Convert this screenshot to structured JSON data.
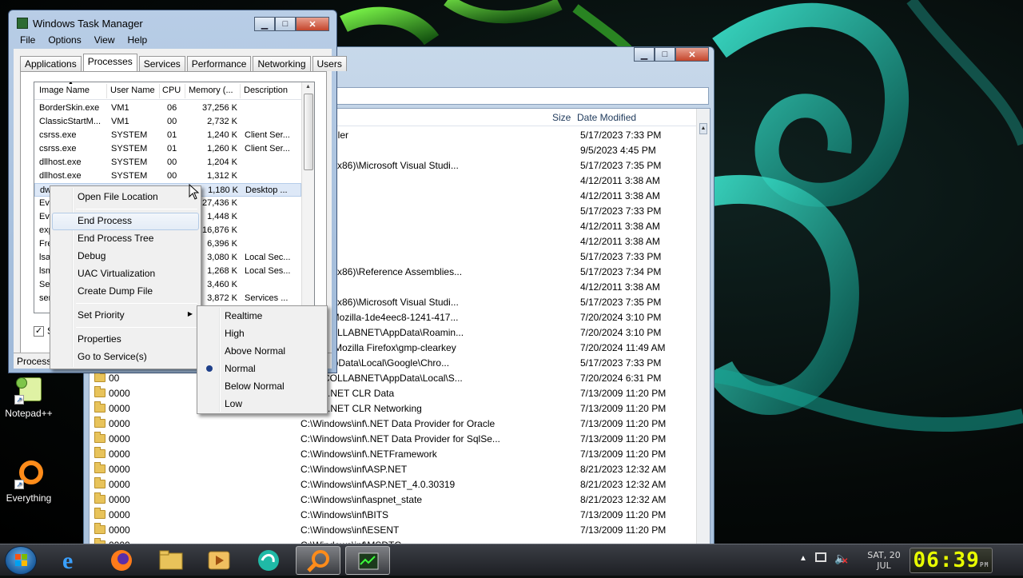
{
  "desktop": {
    "icons": [
      {
        "label": "Notepad++"
      },
      {
        "label": "Everything"
      }
    ]
  },
  "explorer": {
    "columns": {
      "size": "Size",
      "date_modified": "Date Modified"
    },
    "rows": [
      {
        "name": "",
        "path": "ws\\Installer",
        "date": "5/17/2023 7:33 PM"
      },
      {
        "name": "",
        "path": "",
        "date": "9/5/2023 4:45 PM"
      },
      {
        "name": "",
        "path": "m Files (x86)\\Microsoft Visual Studi...",
        "date": "5/17/2023 7:35 PM"
      },
      {
        "name": "",
        "path": "ws\\inf",
        "date": "4/12/2011 3:38 AM"
      },
      {
        "name": "",
        "path": "ws\\inf",
        "date": "4/12/2011 3:38 AM"
      },
      {
        "name": "",
        "path": "ws\\inf",
        "date": "5/17/2023 7:33 PM"
      },
      {
        "name": "",
        "path": "ws\\inf",
        "date": "4/12/2011 3:38 AM"
      },
      {
        "name": "",
        "path": "ws\\inf",
        "date": "4/12/2011 3:38 AM"
      },
      {
        "name": "",
        "path": "ws\\inf",
        "date": "5/17/2023 7:33 PM"
      },
      {
        "name": "",
        "path": "m Files (x86)\\Reference Assemblies...",
        "date": "5/17/2023 7:34 PM"
      },
      {
        "name": "",
        "path": "ws\\inf",
        "date": "4/12/2011 3:38 AM"
      },
      {
        "name": "",
        "path": "m Files (x86)\\Microsoft Visual Studi...",
        "date": "5/17/2023 7:35 PM"
      },
      {
        "name": "",
        "path": "mData\\Mozilla-1de4eec8-1241-417...",
        "date": "7/20/2024 3:10 PM"
      },
      {
        "name": "",
        "path": "VM1.COLLABNET\\AppData\\Roamin...",
        "date": "7/20/2024 3:10 PM"
      },
      {
        "name": "",
        "path": "m Files\\Mozilla Firefox\\gmp-clearkey",
        "date": "7/20/2024 11:49 AM"
      },
      {
        "name": "",
        "path": "vm1\\AppData\\Local\\Google\\Chro...",
        "date": "5/17/2023 7:33 PM"
      },
      {
        "name": "00",
        "path": "VM1.COLLABNET\\AppData\\Local\\S...",
        "date": "7/20/2024 6:31 PM"
      },
      {
        "name": "0000",
        "path": "ws\\inf\\.NET CLR Data",
        "date": "7/13/2009 11:20 PM"
      },
      {
        "name": "0000",
        "path": "ws\\inf\\.NET CLR Networking",
        "date": "7/13/2009 11:20 PM"
      },
      {
        "name": "0000",
        "path": "C:\\Windows\\inf\\.NET Data Provider for Oracle",
        "date": "7/13/2009 11:20 PM"
      },
      {
        "name": "0000",
        "path": "C:\\Windows\\inf\\.NET Data Provider for SqlSe...",
        "date": "7/13/2009 11:20 PM"
      },
      {
        "name": "0000",
        "path": "C:\\Windows\\inf\\.NETFramework",
        "date": "7/13/2009 11:20 PM"
      },
      {
        "name": "0000",
        "path": "C:\\Windows\\inf\\ASP.NET",
        "date": "8/21/2023 12:32 AM"
      },
      {
        "name": "0000",
        "path": "C:\\Windows\\inf\\ASP.NET_4.0.30319",
        "date": "8/21/2023 12:32 AM"
      },
      {
        "name": "0000",
        "path": "C:\\Windows\\inf\\aspnet_state",
        "date": "8/21/2023 12:32 AM"
      },
      {
        "name": "0000",
        "path": "C:\\Windows\\inf\\BITS",
        "date": "7/13/2009 11:20 PM"
      },
      {
        "name": "0000",
        "path": "C:\\Windows\\inf\\ESENT",
        "date": "7/13/2009 11:20 PM"
      },
      {
        "name": "0000",
        "path": "C:\\Windows\\inf\\MSDTC",
        "date": ""
      }
    ]
  },
  "task_manager": {
    "title": "Windows Task Manager",
    "menu": [
      "File",
      "Options",
      "View",
      "Help"
    ],
    "tabs": [
      "Applications",
      "Processes",
      "Services",
      "Performance",
      "Networking",
      "Users"
    ],
    "active_tab": "Processes",
    "columns": [
      "Image Name",
      "User Name",
      "CPU",
      "Memory (...",
      "Description"
    ],
    "processes": [
      {
        "name": "BorderSkin.exe",
        "user": "VM1",
        "cpu": "06",
        "mem": "37,256 K",
        "desc": ""
      },
      {
        "name": "ClassicStartM...",
        "user": "VM1",
        "cpu": "00",
        "mem": "2,732 K",
        "desc": ""
      },
      {
        "name": "csrss.exe",
        "user": "SYSTEM",
        "cpu": "01",
        "mem": "1,240 K",
        "desc": "Client Ser..."
      },
      {
        "name": "csrss.exe",
        "user": "SYSTEM",
        "cpu": "01",
        "mem": "1,260 K",
        "desc": "Client Ser..."
      },
      {
        "name": "dllhost.exe",
        "user": "SYSTEM",
        "cpu": "00",
        "mem": "1,204 K",
        "desc": ""
      },
      {
        "name": "dllhost.exe",
        "user": "SYSTEM",
        "cpu": "00",
        "mem": "1,312 K",
        "desc": ""
      },
      {
        "name": "dw",
        "user": "",
        "cpu": "",
        "mem": "1,180 K",
        "desc": "Desktop ..."
      },
      {
        "name": "Eve",
        "user": "",
        "cpu": "",
        "mem": "27,436 K",
        "desc": ""
      },
      {
        "name": "Eve",
        "user": "",
        "cpu": "",
        "mem": "1,448 K",
        "desc": ""
      },
      {
        "name": "exp",
        "user": "",
        "cpu": "",
        "mem": "16,876 K",
        "desc": ""
      },
      {
        "name": "Fre",
        "user": "",
        "cpu": "",
        "mem": "6,396 K",
        "desc": ""
      },
      {
        "name": "lsa",
        "user": "",
        "cpu": "",
        "mem": "3,080 K",
        "desc": "Local Sec..."
      },
      {
        "name": "lsm",
        "user": "",
        "cpu": "",
        "mem": "1,268 K",
        "desc": "Local Ses..."
      },
      {
        "name": "Sea",
        "user": "",
        "cpu": "",
        "mem": "3,460 K",
        "desc": ""
      },
      {
        "name": "ser",
        "user": "",
        "cpu": "",
        "mem": "3,872 K",
        "desc": "Services ..."
      }
    ],
    "show_all_checkbox": {
      "checked": true,
      "label_visible": "S"
    },
    "status": "Processe"
  },
  "context_menu": {
    "items": [
      "Open File Location",
      "End Process",
      "End Process Tree",
      "Debug",
      "UAC Virtualization",
      "Create Dump File",
      "Set Priority",
      "Properties",
      "Go to Service(s)"
    ],
    "hovered": "End Process"
  },
  "priority_submenu": {
    "items": [
      "Realtime",
      "High",
      "Above Normal",
      "Normal",
      "Below Normal",
      "Low"
    ],
    "selected": "Normal"
  },
  "taskbar": {
    "clock": {
      "day": "SAT, 20",
      "month": "JUL",
      "time": "06:39",
      "ampm": "PM"
    }
  },
  "colors": {
    "selection": "#dde8f7",
    "clock_digits": "#e9ff00",
    "desktop_accent": "#19c7b3"
  }
}
